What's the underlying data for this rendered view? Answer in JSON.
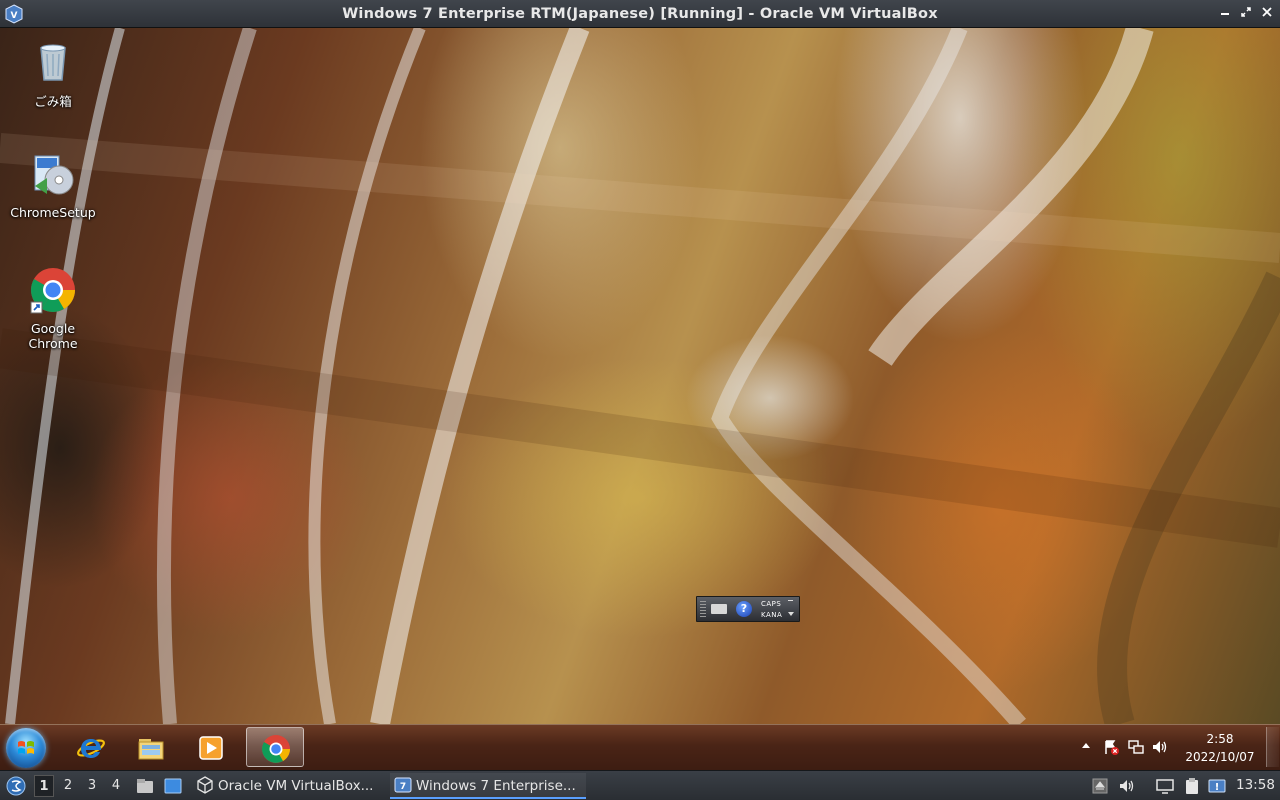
{
  "host_window": {
    "title": "Windows 7 Enterprise RTM(Japanese) [Running] - Oracle VM VirtualBox",
    "buttons": [
      "minimize",
      "maximize",
      "close"
    ]
  },
  "desktop": {
    "icons": [
      {
        "label": "ごみ箱",
        "icon": "recycle-bin-icon"
      },
      {
        "label": "ChromeSetup",
        "icon": "installer-icon"
      },
      {
        "label": "Google Chrome",
        "icon": "chrome-icon"
      }
    ],
    "language_bar": {
      "caps": "CAPS",
      "kana": "KANA",
      "help": "?"
    }
  },
  "guest_taskbar": {
    "pinned": [
      {
        "name": "internet-explorer",
        "icon": "internet-explorer-icon"
      },
      {
        "name": "explorer",
        "icon": "folder-icon"
      },
      {
        "name": "media-player",
        "icon": "media-player-icon"
      },
      {
        "name": "google-chrome",
        "icon": "chrome-icon",
        "active": true
      }
    ],
    "clock": {
      "time": "2:58",
      "date": "2022/10/07"
    }
  },
  "host_panel": {
    "workspaces": [
      "1",
      "2",
      "3",
      "4"
    ],
    "active_workspace": "1",
    "tasks": [
      {
        "label": "Oracle VM VirtualBox...",
        "active": false
      },
      {
        "label": "Windows 7 Enterprise...",
        "active": true
      }
    ],
    "clock": "13:58"
  },
  "colors": {
    "host_bar": "#2e3238",
    "guest_taskbar": "#4a2416",
    "accent": "#5aa0ff"
  }
}
